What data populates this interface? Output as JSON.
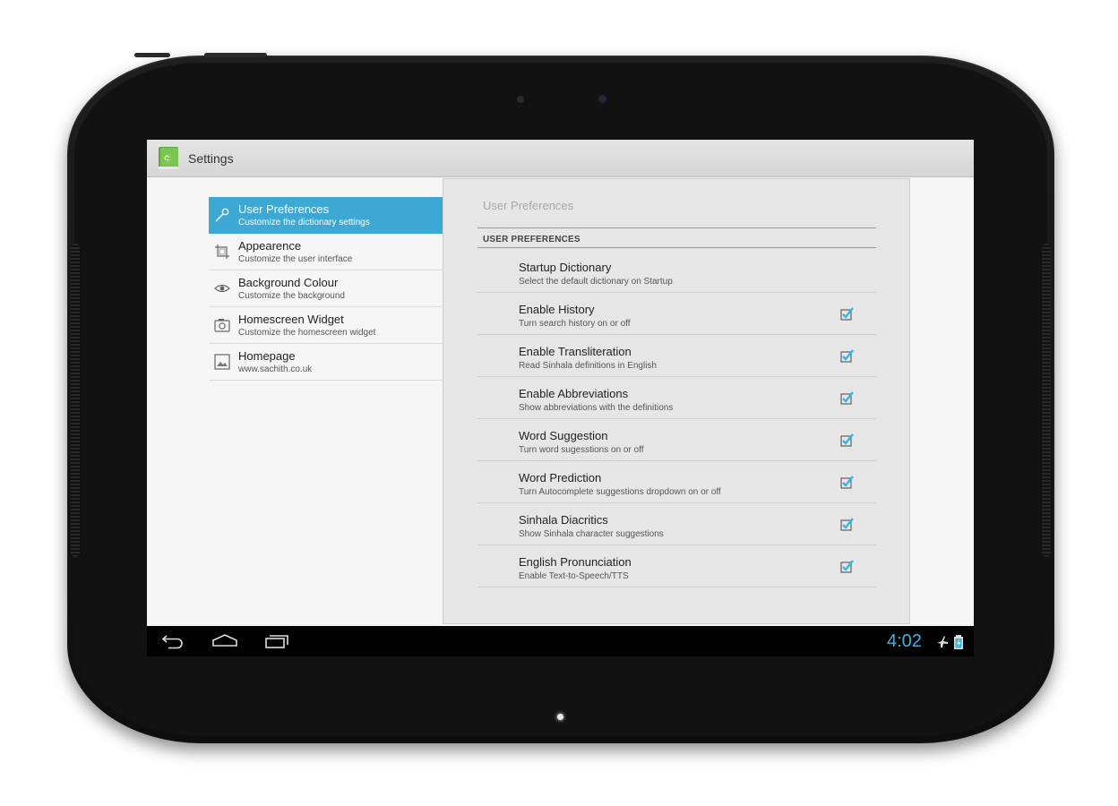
{
  "app": {
    "title": "Settings",
    "icon": "dictionary-book-icon"
  },
  "headers": [
    {
      "title": "User Preferences",
      "subtitle": "Customize the dictionary settings",
      "icon": "wrench-icon",
      "selected": true
    },
    {
      "title": "Appearence",
      "subtitle": "Customize the user interface",
      "icon": "crop-icon",
      "selected": false
    },
    {
      "title": "Background Colour",
      "subtitle": "Customize the background",
      "icon": "eye-icon",
      "selected": false
    },
    {
      "title": "Homescreen Widget",
      "subtitle": "Customize the homescreen widget",
      "icon": "camera-icon",
      "selected": false
    },
    {
      "title": "Homepage",
      "subtitle": "www.sachith.co.uk",
      "icon": "picture-icon",
      "selected": false
    }
  ],
  "detail": {
    "title": "User Preferences",
    "category": "USER PREFERENCES",
    "prefs": [
      {
        "title": "Startup Dictionary",
        "subtitle": "Select the default dictionary on Startup",
        "checkbox": false,
        "checked": false
      },
      {
        "title": "Enable History",
        "subtitle": "Turn search history on or off",
        "checkbox": true,
        "checked": true
      },
      {
        "title": "Enable Transliteration",
        "subtitle": "Read Sinhala definitions in English",
        "checkbox": true,
        "checked": true
      },
      {
        "title": "Enable Abbreviations",
        "subtitle": "Show abbreviations with the definitions",
        "checkbox": true,
        "checked": true
      },
      {
        "title": "Word Suggestion",
        "subtitle": "Turn word sugesstions on or off",
        "checkbox": true,
        "checked": true
      },
      {
        "title": "Word Prediction",
        "subtitle": "Turn Autocomplete suggestions dropdown on or off",
        "checkbox": true,
        "checked": true
      },
      {
        "title": "Sinhala Diacritics",
        "subtitle": "Show Sinhala character suggestions",
        "checkbox": true,
        "checked": true
      },
      {
        "title": "English Pronunciation",
        "subtitle": "Enable Text-to-Speech/TTS",
        "checkbox": true,
        "checked": true
      }
    ]
  },
  "navbar": {
    "buttons": [
      "back-icon",
      "home-icon",
      "recent-apps-icon"
    ],
    "time": "4:02",
    "status_icons": [
      "airplane-mode-icon",
      "battery-charging-icon"
    ]
  },
  "colors": {
    "accent": "#33b5e5",
    "selected_header": "#3ea8d4",
    "action_bar": "#dcdcdc",
    "detail_bg": "#e6e6e6"
  }
}
